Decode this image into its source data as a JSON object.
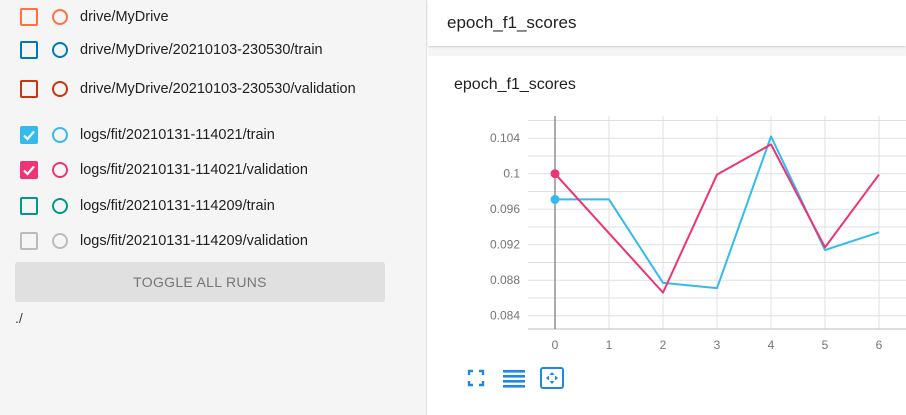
{
  "sidebar": {
    "runs": [
      {
        "label": "drive/MyDrive",
        "color": "#ff7043",
        "checked": false
      },
      {
        "label": "drive/MyDrive/20210103-230530/train",
        "color": "#0077bb",
        "checked": false
      },
      {
        "label": "drive/MyDrive/20210103-230530/validation",
        "color": "#cc3311",
        "checked": false
      },
      {
        "label": "logs/fit/20210131-114021/train",
        "color": "#33bbee",
        "checked": true
      },
      {
        "label": "logs/fit/20210131-114021/validation",
        "color": "#ee3377",
        "checked": true
      },
      {
        "label": "logs/fit/20210131-114209/train",
        "color": "#009988",
        "checked": false
      },
      {
        "label": "logs/fit/20210131-114209/validation",
        "color": "#bbbbbb",
        "checked": false
      }
    ],
    "toggle_label": "TOGGLE ALL RUNS",
    "path": "./"
  },
  "card": {
    "header_title": "epoch_f1_scores"
  },
  "chart_data": {
    "type": "line",
    "title": "epoch_f1_scores",
    "x": [
      0,
      1,
      2,
      3,
      4,
      5,
      6
    ],
    "xlim": [
      -0.5,
      6.5
    ],
    "ylim": [
      0.0825,
      0.1065
    ],
    "yticks": [
      0.084,
      0.088,
      0.092,
      0.096,
      0.1,
      0.104
    ],
    "ytick_labels": [
      "0.084",
      "0.088",
      "0.092",
      "0.096",
      "0.1",
      "0.104"
    ],
    "xtick_labels": [
      "0",
      "1",
      "2",
      "3",
      "4",
      "5",
      "6"
    ],
    "grid": true,
    "series": [
      {
        "color": "#33bbee",
        "values": [
          0.0971,
          0.0971,
          0.0877,
          0.0871,
          0.1042,
          0.0914,
          0.0934
        ]
      },
      {
        "color": "#ee3377",
        "values": [
          0.1,
          0.0933,
          0.0866,
          0.0999,
          0.1033,
          0.0917,
          0.0999
        ]
      }
    ],
    "cursor_x": 0
  },
  "icons": {
    "fullscreen": "fullscreen-icon",
    "legend": "legend-toggle-icon",
    "fit": "fit-domain-icon"
  },
  "colors": {
    "accent": "#1e88e5"
  }
}
